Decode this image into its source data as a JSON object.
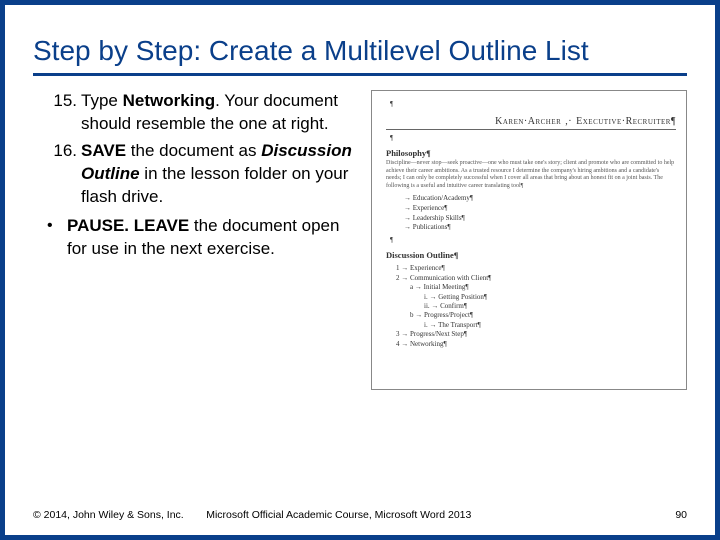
{
  "title": "Step by Step: Create a Multilevel Outline List",
  "steps": [
    {
      "num": "15.",
      "parts": [
        {
          "t": "Type "
        },
        {
          "t": "Networking",
          "b": true
        },
        {
          "t": ". Your document should resemble the one at right."
        }
      ]
    },
    {
      "num": "16.",
      "parts": [
        {
          "t": " "
        },
        {
          "t": "SAVE",
          "b": true
        },
        {
          "t": " the document as "
        },
        {
          "t": "Discussion Outline",
          "bi": true
        },
        {
          "t": " in the lesson folder on your flash drive."
        }
      ]
    }
  ],
  "bullet": {
    "parts": [
      {
        "t": "PAUSE. LEAVE",
        "b": true
      },
      {
        "t": " the document open for use in the next exercise."
      }
    ]
  },
  "doc": {
    "name_first": "Karen·Archer",
    "name_sep": ",·",
    "name_role": "Executive·Recruiter¶",
    "heading1": "Philosophy¶",
    "para1": "Discipline—never stop—seek proactive—one who must take one's story; client and promote who are committed to help achieve their career ambitions. As a trusted resource I determine the company's hiring ambitions and a candidate's needs; I can only be completely successful when I cover all areas that bring about an honest fit on a joint basis. The following is a useful and intuitive career translating tool¶",
    "arrows": [
      "Education/Academy¶",
      "Experience¶",
      "Leadership Skills¶",
      "Publications¶"
    ],
    "heading2": "Discussion Outline¶",
    "outline": [
      {
        "lvl": 1,
        "t": "1 → Experience¶"
      },
      {
        "lvl": 1,
        "t": "2 → Communication with Client¶"
      },
      {
        "lvl": 2,
        "t": "a → Initial Meeting¶"
      },
      {
        "lvl": 3,
        "t": "i. → Getting Position¶"
      },
      {
        "lvl": 3,
        "t": "ii. → Confirm¶"
      },
      {
        "lvl": 2,
        "t": "b → Progress/Project¶"
      },
      {
        "lvl": 3,
        "t": "i. → The Transport¶"
      },
      {
        "lvl": 1,
        "t": "3 → Progress/Next Step¶"
      },
      {
        "lvl": 1,
        "t": "4 → Networking¶"
      }
    ]
  },
  "footer": {
    "left": "© 2014, John Wiley & Sons, Inc.",
    "center": "Microsoft Official Academic Course, Microsoft Word 2013",
    "right": "90"
  }
}
